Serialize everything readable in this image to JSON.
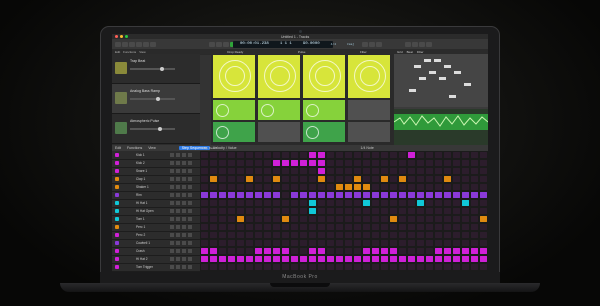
{
  "device": {
    "label": "MacBook Pro"
  },
  "titlebar": {
    "title": "Untitled 1 - Tracks"
  },
  "controlbar": {
    "items": [
      "Edit",
      "Functions",
      "View"
    ],
    "lcd_time": "00:00:01.238",
    "lcd_bars": "1 1 1",
    "lcd_bars2": "2 1 1",
    "lcd_tempo": "90.0000",
    "lcd_keep": "Keep Tempo",
    "lcd_sig": "4/4",
    "lcd_key": "Cmaj"
  },
  "tracks": {
    "header": [
      "Edit",
      "Functions",
      "View"
    ],
    "items": [
      {
        "name": "Trap Beat"
      },
      {
        "name": "Analog Bass Ramp"
      },
      {
        "name": "Atmospheric Pulse"
      }
    ]
  },
  "live_cells": {
    "header": [
      "Drop Ready",
      "Pulse",
      "Filter"
    ],
    "colors": {
      "yellow": "#d7e53a",
      "lime": "#86d23b",
      "empty": "#505050"
    }
  },
  "editor": {
    "header": [
      "Grid",
      "Beat",
      "Filter"
    ]
  },
  "step_sequencer": {
    "tabs": [
      "Edit",
      "Functions",
      "View",
      "Step Sequencer",
      "Velocity / Value"
    ],
    "active_tab": "Step Sequencer",
    "pattern": "Trap Beat 1",
    "zoom": "1/4 Note",
    "rows": [
      {
        "name": "Kick 1",
        "color": "#d020d8"
      },
      {
        "name": "Kick 2",
        "color": "#d020d8"
      },
      {
        "name": "Snare 1",
        "color": "#d020d8"
      },
      {
        "name": "Clap 1",
        "color": "#e08a10"
      },
      {
        "name": "Shaker 1",
        "color": "#e08a10"
      },
      {
        "name": "Rim",
        "color": "#8a3ad8"
      },
      {
        "name": "Hi Hat 1",
        "color": "#10c8d8"
      },
      {
        "name": "Hi Hat Open",
        "color": "#10c8d8"
      },
      {
        "name": "Tom 1",
        "color": "#10c8d8"
      },
      {
        "name": "Perc 1",
        "color": "#e08a10"
      },
      {
        "name": "Perc 2",
        "color": "#d020d8"
      },
      {
        "name": "Cowbell 1",
        "color": "#8a3ad8"
      },
      {
        "name": "Crash",
        "color": "#d020d8"
      },
      {
        "name": "Hi Hat 2",
        "color": "#d020d8"
      },
      {
        "name": "Tom Trigger",
        "color": "#d020d8"
      }
    ],
    "steps": [
      [
        0,
        0,
        0,
        0,
        0,
        0,
        0,
        0,
        0,
        0,
        0,
        0,
        1,
        1,
        0,
        0,
        0,
        0,
        0,
        0,
        0,
        0,
        0,
        1,
        0,
        0,
        0,
        0,
        0,
        0,
        0,
        0
      ],
      [
        0,
        0,
        0,
        0,
        0,
        0,
        0,
        0,
        1,
        1,
        1,
        1,
        1,
        1,
        0,
        0,
        0,
        0,
        0,
        0,
        0,
        0,
        0,
        0,
        0,
        0,
        0,
        0,
        0,
        0,
        0,
        0
      ],
      [
        0,
        0,
        0,
        0,
        0,
        0,
        0,
        0,
        0,
        0,
        0,
        0,
        0,
        1,
        0,
        0,
        0,
        0,
        0,
        0,
        0,
        0,
        0,
        0,
        0,
        0,
        0,
        0,
        0,
        0,
        0,
        0
      ],
      [
        0,
        1,
        0,
        0,
        0,
        1,
        0,
        0,
        1,
        0,
        0,
        0,
        0,
        1,
        0,
        0,
        0,
        1,
        0,
        0,
        1,
        0,
        1,
        0,
        0,
        0,
        0,
        1,
        0,
        0,
        0,
        0
      ],
      [
        0,
        0,
        0,
        0,
        0,
        0,
        0,
        0,
        0,
        0,
        0,
        0,
        0,
        0,
        0,
        1,
        1,
        1,
        1,
        0,
        0,
        0,
        0,
        0,
        0,
        0,
        0,
        0,
        0,
        0,
        0,
        0
      ],
      [
        1,
        1,
        1,
        1,
        1,
        1,
        1,
        1,
        1,
        0,
        1,
        1,
        1,
        1,
        1,
        1,
        1,
        1,
        1,
        1,
        1,
        1,
        1,
        1,
        1,
        1,
        1,
        1,
        1,
        1,
        1,
        1
      ],
      [
        0,
        0,
        0,
        0,
        0,
        0,
        0,
        0,
        0,
        0,
        0,
        0,
        1,
        0,
        0,
        0,
        0,
        0,
        1,
        0,
        0,
        0,
        0,
        0,
        1,
        0,
        0,
        0,
        0,
        1,
        0,
        0
      ],
      [
        0,
        0,
        0,
        0,
        0,
        0,
        0,
        0,
        0,
        0,
        0,
        0,
        1,
        0,
        0,
        0,
        0,
        0,
        0,
        0,
        0,
        0,
        0,
        0,
        0,
        0,
        0,
        0,
        0,
        0,
        0,
        0
      ],
      [
        0,
        0,
        0,
        0,
        1,
        0,
        0,
        0,
        0,
        1,
        0,
        0,
        0,
        0,
        0,
        0,
        0,
        0,
        0,
        0,
        0,
        1,
        0,
        0,
        0,
        0,
        0,
        0,
        0,
        0,
        0,
        1
      ],
      [
        0,
        0,
        0,
        0,
        0,
        0,
        0,
        0,
        0,
        0,
        0,
        0,
        0,
        0,
        0,
        0,
        0,
        0,
        0,
        0,
        0,
        0,
        0,
        0,
        0,
        0,
        0,
        0,
        0,
        0,
        0,
        0
      ],
      [
        0,
        0,
        0,
        0,
        0,
        0,
        0,
        0,
        0,
        0,
        0,
        0,
        0,
        0,
        0,
        0,
        0,
        0,
        0,
        0,
        0,
        0,
        0,
        0,
        0,
        0,
        0,
        0,
        0,
        0,
        0,
        0
      ],
      [
        0,
        0,
        0,
        0,
        0,
        0,
        0,
        0,
        0,
        0,
        0,
        0,
        0,
        0,
        0,
        0,
        0,
        0,
        0,
        0,
        0,
        0,
        0,
        0,
        0,
        0,
        0,
        0,
        0,
        0,
        0,
        0
      ],
      [
        1,
        1,
        0,
        0,
        0,
        0,
        1,
        1,
        1,
        1,
        0,
        0,
        1,
        1,
        0,
        0,
        0,
        0,
        1,
        1,
        1,
        1,
        0,
        0,
        0,
        0,
        1,
        1,
        1,
        1,
        1,
        1
      ],
      [
        1,
        1,
        1,
        1,
        1,
        1,
        1,
        1,
        1,
        1,
        1,
        1,
        1,
        1,
        1,
        1,
        1,
        1,
        1,
        1,
        1,
        1,
        1,
        1,
        1,
        1,
        1,
        1,
        1,
        1,
        1,
        1
      ],
      [
        0,
        0,
        0,
        0,
        0,
        0,
        0,
        0,
        0,
        0,
        0,
        0,
        0,
        0,
        0,
        0,
        0,
        0,
        0,
        0,
        0,
        0,
        0,
        0,
        0,
        0,
        0,
        0,
        0,
        0,
        0,
        0
      ]
    ],
    "step_row_colors": [
      "#d020d8",
      "#d020d8",
      "#d020d8",
      "#e08a10",
      "#e08a10",
      "#8a3ad8",
      "#10c8d8",
      "#10c8d8",
      "#e08a10",
      "#e08a10",
      "#d020d8",
      "#d020d8",
      "#d020d8",
      "#d020d8",
      "#d020d8"
    ]
  },
  "colors": {
    "accent": "#2e7be6",
    "play": "#2fa33a",
    "record": "#e04a3a"
  }
}
